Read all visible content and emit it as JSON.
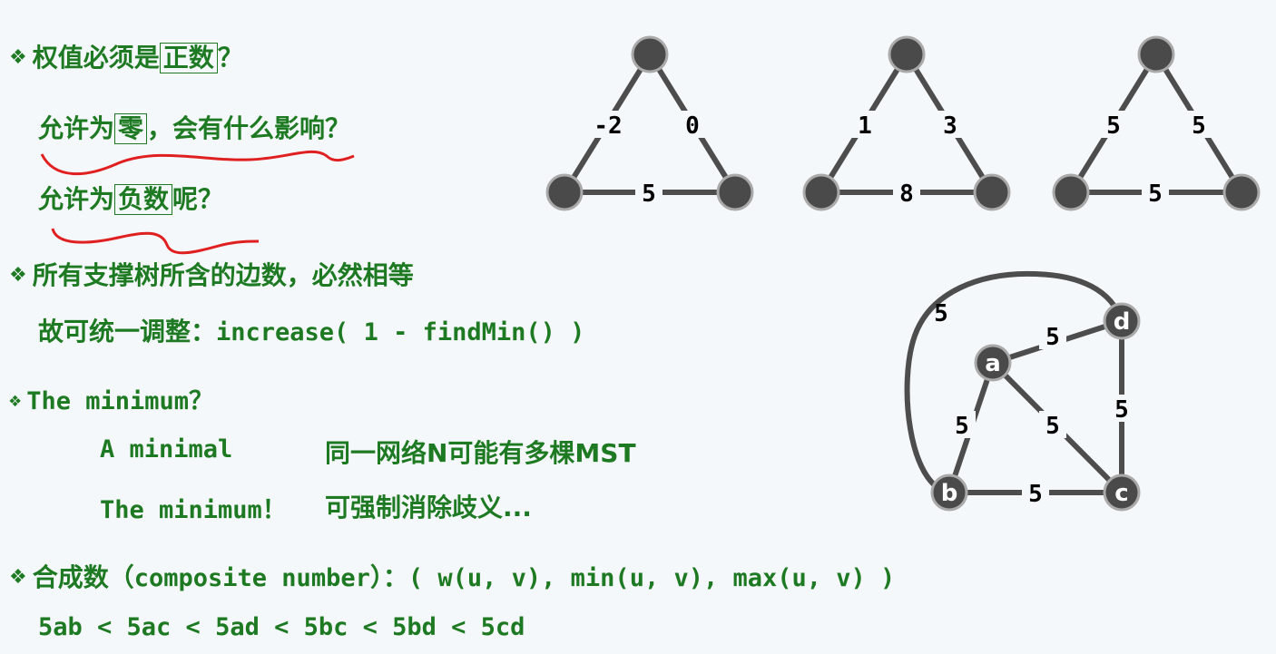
{
  "bullets": {
    "symbol": "❖"
  },
  "lines": {
    "l1_a": "权值必须是",
    "l1_box": "正数",
    "l1_b": "？",
    "l2_a": "允许为",
    "l2_box": "零",
    "l2_b": "，会有什么影响？",
    "l3_a": "允许为",
    "l3_box": "负数",
    "l3_b": "呢？",
    "l4": "所有支撑树所含的边数，必然相等",
    "l5_a": "故可统一调整：",
    "l5_b": "increase( 1 - findMin() )",
    "l6": "The minimum？",
    "l7_a": "A minimal",
    "l7_b": "同一网络N可能有多棵MST",
    "l8_a": "The minimum！",
    "l8_b": "可强制消除歧义...",
    "l9_a": "合成数（",
    "l9_b": "composite number",
    "l9_c": "）：",
    "l9_d": "( w(u, v), min(u, v), max(u, v) )",
    "l10": "5ab < 5ac < 5ad < 5bc < 5bd < 5cd"
  },
  "triangles": [
    {
      "left": "-2",
      "right": "0",
      "bottom": "5"
    },
    {
      "left": "1",
      "right": "3",
      "bottom": "8"
    },
    {
      "left": "5",
      "right": "5",
      "bottom": "5"
    }
  ],
  "graph": {
    "nodes": {
      "a": "a",
      "b": "b",
      "c": "c",
      "d": "d"
    },
    "edges": {
      "ad": "5",
      "ab": "5",
      "ac": "5",
      "bc": "5",
      "dc": "5",
      "bd": "5"
    }
  },
  "colors": {
    "text": "#1e7a22",
    "node": "#4a4a4a",
    "edge": "#4d4d4d",
    "underline": "#e02020"
  }
}
